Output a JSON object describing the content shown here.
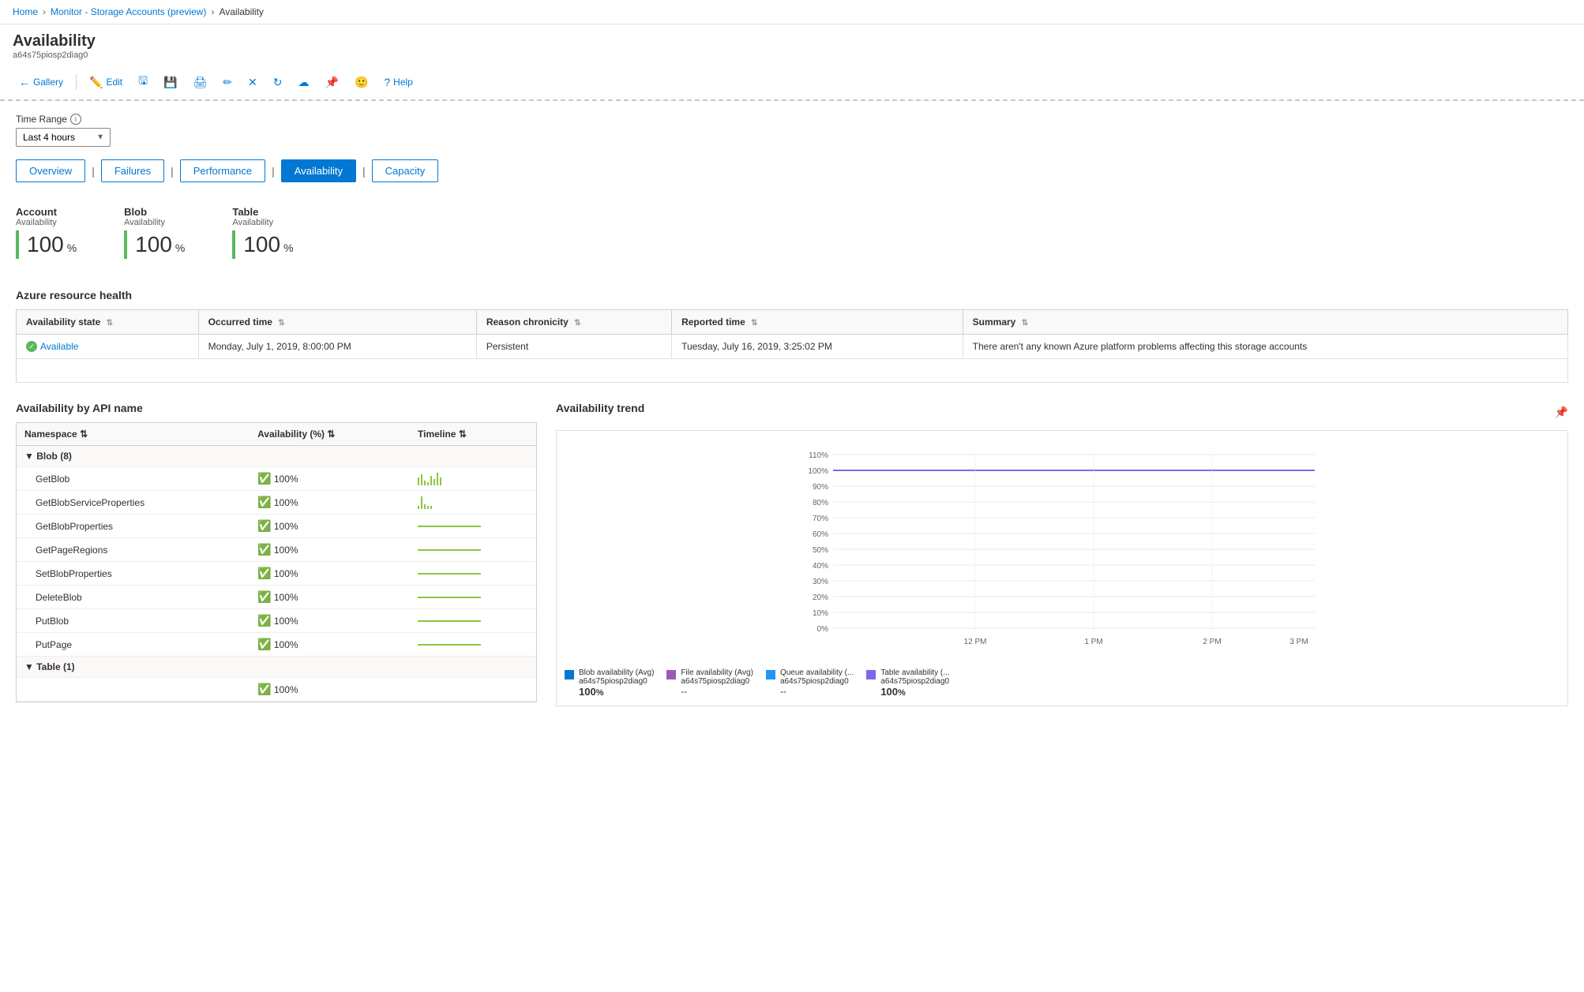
{
  "breadcrumb": {
    "items": [
      "Home",
      "Monitor - Storage Accounts (preview)",
      "Availability"
    ]
  },
  "header": {
    "title": "Availability",
    "subtitle": "a64s75piosp2diag0"
  },
  "toolbar": {
    "gallery": "Gallery",
    "edit": "Edit",
    "help": "Help"
  },
  "time_range": {
    "label": "Time Range",
    "value": "Last 4 hours"
  },
  "tabs": [
    {
      "label": "Overview",
      "active": false
    },
    {
      "label": "Failures",
      "active": false
    },
    {
      "label": "Performance",
      "active": false
    },
    {
      "label": "Availability",
      "active": true
    },
    {
      "label": "Capacity",
      "active": false
    }
  ],
  "metrics": [
    {
      "name": "Account",
      "sublabel": "Availability",
      "value": "100",
      "unit": "%"
    },
    {
      "name": "Blob",
      "sublabel": "Availability",
      "value": "100",
      "unit": "%"
    },
    {
      "name": "Table",
      "sublabel": "Availability",
      "value": "100",
      "unit": "%"
    }
  ],
  "resource_health": {
    "title": "Azure resource health",
    "columns": [
      "Availability state",
      "Occurred time",
      "Reason chronicity",
      "Reported time",
      "Summary"
    ],
    "rows": [
      {
        "state": "Available",
        "occurred": "Monday, July 1, 2019, 8:00:00 PM",
        "reason": "Persistent",
        "reported": "Tuesday, July 16, 2019, 3:25:02 PM",
        "summary": "There aren't any known Azure platform problems affecting this storage accounts"
      }
    ]
  },
  "api_section": {
    "title": "Availability by API name",
    "columns": [
      "Namespace",
      "Availability (%)",
      "Timeline"
    ],
    "groups": [
      {
        "name": "Blob (8)",
        "items": [
          {
            "name": "GetBlob",
            "availability": "100%"
          },
          {
            "name": "GetBlobServiceProperties",
            "availability": "100%"
          },
          {
            "name": "GetBlobProperties",
            "availability": "100%"
          },
          {
            "name": "GetPageRegions",
            "availability": "100%"
          },
          {
            "name": "SetBlobProperties",
            "availability": "100%"
          },
          {
            "name": "DeleteBlob",
            "availability": "100%"
          },
          {
            "name": "PutBlob",
            "availability": "100%"
          },
          {
            "name": "PutPage",
            "availability": "100%"
          }
        ]
      },
      {
        "name": "Table (1)",
        "items": []
      }
    ]
  },
  "trend_section": {
    "title": "Availability trend",
    "y_labels": [
      "110%",
      "100%",
      "90%",
      "80%",
      "70%",
      "60%",
      "50%",
      "40%",
      "30%",
      "20%",
      "10%",
      "0%"
    ],
    "x_labels": [
      "12 PM",
      "1 PM",
      "2 PM",
      "3 PM"
    ],
    "legend": [
      {
        "label": "Blob availability (Avg)\na64s75piosp2diag0",
        "value": "100%",
        "color": "#0078d4"
      },
      {
        "label": "File availability (Avg)\na64s75piosp2diag0",
        "value": "--",
        "color": "#9b59b6"
      },
      {
        "label": "Queue availability (...\na64s75piosp2diag0",
        "value": "--",
        "color": "#2196f3"
      },
      {
        "label": "Table availability (...\na64s75piosp2diag0",
        "value": "100%",
        "color": "#7b68ee"
      }
    ]
  }
}
